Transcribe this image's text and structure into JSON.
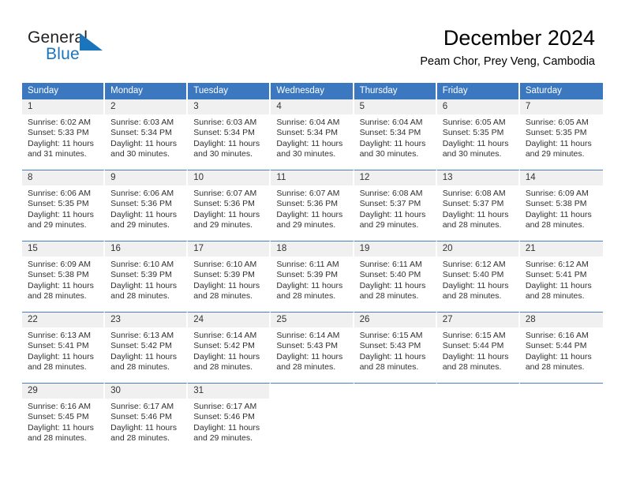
{
  "brand": {
    "name_part1": "General",
    "name_part2": "Blue",
    "triangle_color": "#1b75bc",
    "text_color": "#231f20"
  },
  "header": {
    "month_title": "December 2024",
    "location": "Peam Chor, Prey Veng, Cambodia"
  },
  "theme": {
    "header_blue": "#3b78c0",
    "daynum_bg": "#f0f0f0",
    "row_divider": "#4a7fc1",
    "body_text": "#303030"
  },
  "calendar": {
    "weekday_headers": [
      "Sunday",
      "Monday",
      "Tuesday",
      "Wednesday",
      "Thursday",
      "Friday",
      "Saturday"
    ],
    "weeks": [
      [
        {
          "day": "1",
          "sunrise": "Sunrise: 6:02 AM",
          "sunset": "Sunset: 5:33 PM",
          "daylight_line1": "Daylight: 11 hours",
          "daylight_line2": "and 31 minutes."
        },
        {
          "day": "2",
          "sunrise": "Sunrise: 6:03 AM",
          "sunset": "Sunset: 5:34 PM",
          "daylight_line1": "Daylight: 11 hours",
          "daylight_line2": "and 30 minutes."
        },
        {
          "day": "3",
          "sunrise": "Sunrise: 6:03 AM",
          "sunset": "Sunset: 5:34 PM",
          "daylight_line1": "Daylight: 11 hours",
          "daylight_line2": "and 30 minutes."
        },
        {
          "day": "4",
          "sunrise": "Sunrise: 6:04 AM",
          "sunset": "Sunset: 5:34 PM",
          "daylight_line1": "Daylight: 11 hours",
          "daylight_line2": "and 30 minutes."
        },
        {
          "day": "5",
          "sunrise": "Sunrise: 6:04 AM",
          "sunset": "Sunset: 5:34 PM",
          "daylight_line1": "Daylight: 11 hours",
          "daylight_line2": "and 30 minutes."
        },
        {
          "day": "6",
          "sunrise": "Sunrise: 6:05 AM",
          "sunset": "Sunset: 5:35 PM",
          "daylight_line1": "Daylight: 11 hours",
          "daylight_line2": "and 30 minutes."
        },
        {
          "day": "7",
          "sunrise": "Sunrise: 6:05 AM",
          "sunset": "Sunset: 5:35 PM",
          "daylight_line1": "Daylight: 11 hours",
          "daylight_line2": "and 29 minutes."
        }
      ],
      [
        {
          "day": "8",
          "sunrise": "Sunrise: 6:06 AM",
          "sunset": "Sunset: 5:35 PM",
          "daylight_line1": "Daylight: 11 hours",
          "daylight_line2": "and 29 minutes."
        },
        {
          "day": "9",
          "sunrise": "Sunrise: 6:06 AM",
          "sunset": "Sunset: 5:36 PM",
          "daylight_line1": "Daylight: 11 hours",
          "daylight_line2": "and 29 minutes."
        },
        {
          "day": "10",
          "sunrise": "Sunrise: 6:07 AM",
          "sunset": "Sunset: 5:36 PM",
          "daylight_line1": "Daylight: 11 hours",
          "daylight_line2": "and 29 minutes."
        },
        {
          "day": "11",
          "sunrise": "Sunrise: 6:07 AM",
          "sunset": "Sunset: 5:36 PM",
          "daylight_line1": "Daylight: 11 hours",
          "daylight_line2": "and 29 minutes."
        },
        {
          "day": "12",
          "sunrise": "Sunrise: 6:08 AM",
          "sunset": "Sunset: 5:37 PM",
          "daylight_line1": "Daylight: 11 hours",
          "daylight_line2": "and 29 minutes."
        },
        {
          "day": "13",
          "sunrise": "Sunrise: 6:08 AM",
          "sunset": "Sunset: 5:37 PM",
          "daylight_line1": "Daylight: 11 hours",
          "daylight_line2": "and 28 minutes."
        },
        {
          "day": "14",
          "sunrise": "Sunrise: 6:09 AM",
          "sunset": "Sunset: 5:38 PM",
          "daylight_line1": "Daylight: 11 hours",
          "daylight_line2": "and 28 minutes."
        }
      ],
      [
        {
          "day": "15",
          "sunrise": "Sunrise: 6:09 AM",
          "sunset": "Sunset: 5:38 PM",
          "daylight_line1": "Daylight: 11 hours",
          "daylight_line2": "and 28 minutes."
        },
        {
          "day": "16",
          "sunrise": "Sunrise: 6:10 AM",
          "sunset": "Sunset: 5:39 PM",
          "daylight_line1": "Daylight: 11 hours",
          "daylight_line2": "and 28 minutes."
        },
        {
          "day": "17",
          "sunrise": "Sunrise: 6:10 AM",
          "sunset": "Sunset: 5:39 PM",
          "daylight_line1": "Daylight: 11 hours",
          "daylight_line2": "and 28 minutes."
        },
        {
          "day": "18",
          "sunrise": "Sunrise: 6:11 AM",
          "sunset": "Sunset: 5:39 PM",
          "daylight_line1": "Daylight: 11 hours",
          "daylight_line2": "and 28 minutes."
        },
        {
          "day": "19",
          "sunrise": "Sunrise: 6:11 AM",
          "sunset": "Sunset: 5:40 PM",
          "daylight_line1": "Daylight: 11 hours",
          "daylight_line2": "and 28 minutes."
        },
        {
          "day": "20",
          "sunrise": "Sunrise: 6:12 AM",
          "sunset": "Sunset: 5:40 PM",
          "daylight_line1": "Daylight: 11 hours",
          "daylight_line2": "and 28 minutes."
        },
        {
          "day": "21",
          "sunrise": "Sunrise: 6:12 AM",
          "sunset": "Sunset: 5:41 PM",
          "daylight_line1": "Daylight: 11 hours",
          "daylight_line2": "and 28 minutes."
        }
      ],
      [
        {
          "day": "22",
          "sunrise": "Sunrise: 6:13 AM",
          "sunset": "Sunset: 5:41 PM",
          "daylight_line1": "Daylight: 11 hours",
          "daylight_line2": "and 28 minutes."
        },
        {
          "day": "23",
          "sunrise": "Sunrise: 6:13 AM",
          "sunset": "Sunset: 5:42 PM",
          "daylight_line1": "Daylight: 11 hours",
          "daylight_line2": "and 28 minutes."
        },
        {
          "day": "24",
          "sunrise": "Sunrise: 6:14 AM",
          "sunset": "Sunset: 5:42 PM",
          "daylight_line1": "Daylight: 11 hours",
          "daylight_line2": "and 28 minutes."
        },
        {
          "day": "25",
          "sunrise": "Sunrise: 6:14 AM",
          "sunset": "Sunset: 5:43 PM",
          "daylight_line1": "Daylight: 11 hours",
          "daylight_line2": "and 28 minutes."
        },
        {
          "day": "26",
          "sunrise": "Sunrise: 6:15 AM",
          "sunset": "Sunset: 5:43 PM",
          "daylight_line1": "Daylight: 11 hours",
          "daylight_line2": "and 28 minutes."
        },
        {
          "day": "27",
          "sunrise": "Sunrise: 6:15 AM",
          "sunset": "Sunset: 5:44 PM",
          "daylight_line1": "Daylight: 11 hours",
          "daylight_line2": "and 28 minutes."
        },
        {
          "day": "28",
          "sunrise": "Sunrise: 6:16 AM",
          "sunset": "Sunset: 5:44 PM",
          "daylight_line1": "Daylight: 11 hours",
          "daylight_line2": "and 28 minutes."
        }
      ],
      [
        {
          "day": "29",
          "sunrise": "Sunrise: 6:16 AM",
          "sunset": "Sunset: 5:45 PM",
          "daylight_line1": "Daylight: 11 hours",
          "daylight_line2": "and 28 minutes."
        },
        {
          "day": "30",
          "sunrise": "Sunrise: 6:17 AM",
          "sunset": "Sunset: 5:46 PM",
          "daylight_line1": "Daylight: 11 hours",
          "daylight_line2": "and 28 minutes."
        },
        {
          "day": "31",
          "sunrise": "Sunrise: 6:17 AM",
          "sunset": "Sunset: 5:46 PM",
          "daylight_line1": "Daylight: 11 hours",
          "daylight_line2": "and 29 minutes."
        },
        null,
        null,
        null,
        null
      ]
    ]
  }
}
